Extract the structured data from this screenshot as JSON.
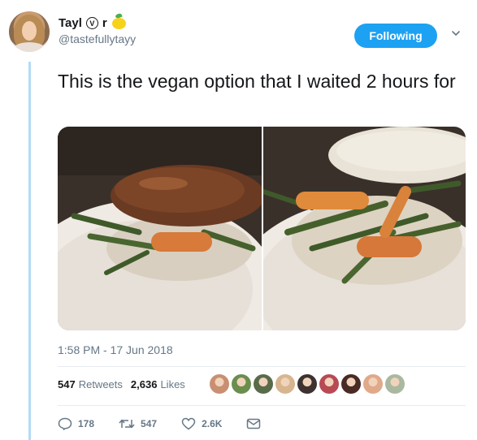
{
  "user": {
    "display_name_part1": "Tayl",
    "vegan_symbol": "V",
    "display_name_part2": "r",
    "handle": "@tastefullytayy"
  },
  "follow_button": {
    "label": "Following"
  },
  "tweet": {
    "text": "This is the vegan option that I waited 2 hours for",
    "timestamp": "1:58 PM - 17 Jun 2018"
  },
  "stats": {
    "retweets_count": "547",
    "retweets_label": "Retweets",
    "likes_count": "2,636",
    "likes_label": "Likes"
  },
  "likers": [
    {
      "color": "#c98f72"
    },
    {
      "color": "#6b8e4e"
    },
    {
      "color": "#5a6b4a"
    },
    {
      "color": "#d7b58e"
    },
    {
      "color": "#3d3230"
    },
    {
      "color": "#b74a55"
    },
    {
      "color": "#4a2a24"
    },
    {
      "color": "#e0a98a"
    },
    {
      "color": "#aab8a0"
    }
  ],
  "actions": {
    "reply_count": "178",
    "retweet_count": "547",
    "like_count": "2.6K"
  },
  "colors": {
    "accent": "#1da1f2",
    "secondary_text": "#657786",
    "thread_line": "#b3dbf7"
  }
}
